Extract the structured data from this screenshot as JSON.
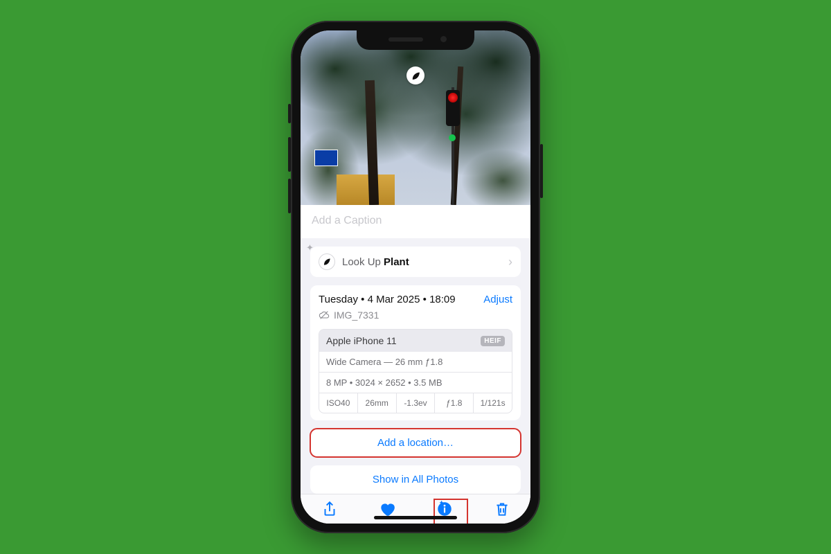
{
  "caption": {
    "placeholder": "Add a Caption"
  },
  "lookup": {
    "prefix": "Look Up ",
    "subject": "Plant"
  },
  "date": {
    "weekday": "Tuesday",
    "date": "4 Mar 2025",
    "time": "18:09",
    "adjust": "Adjust",
    "filename": "IMG_7331"
  },
  "device": {
    "model": "Apple iPhone 11",
    "format": "HEIF",
    "lens": "Wide Camera — 26 mm ƒ1.8",
    "res": "8 MP  •  3024 × 2652  •  3.5 MB",
    "exif": {
      "iso": "ISO40",
      "focal": "26mm",
      "ev": "-1.3ev",
      "aperture": "ƒ1.8",
      "shutter": "1/121s"
    }
  },
  "actions": {
    "add_location": "Add a location…",
    "show_all": "Show in All Photos"
  },
  "colors": {
    "accent": "#0a7aff",
    "highlight": "#d4342f",
    "canvas": "#3a9a33"
  }
}
